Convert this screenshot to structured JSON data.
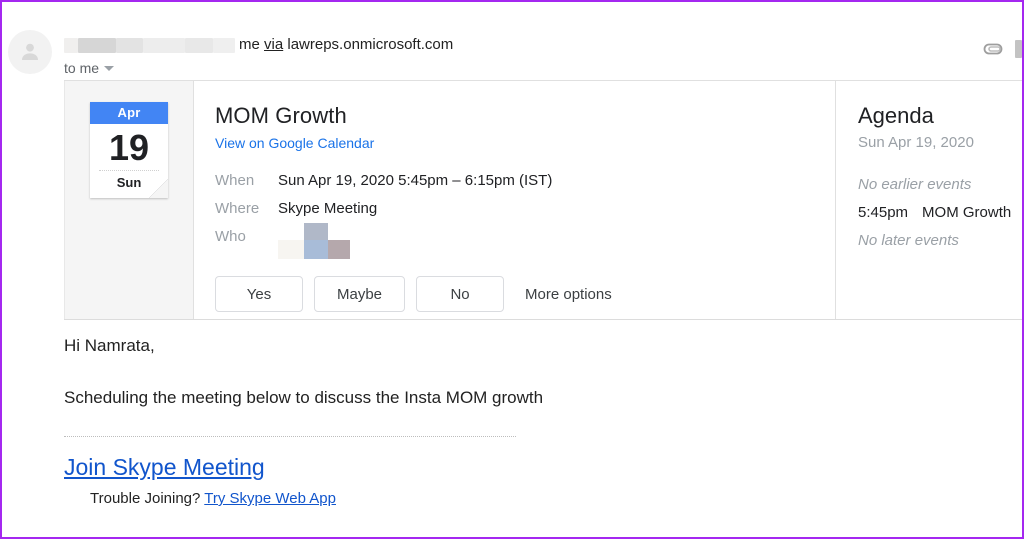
{
  "header": {
    "sender_redacted": true,
    "recipient_short": "me",
    "via_label": "via",
    "via_domain": "lawreps.onmicrosoft.com",
    "to_line": "to me",
    "attachment_icon": "paperclip-icon",
    "avatar_icon": "person-avatar-icon"
  },
  "invite": {
    "date_card": {
      "month": "Apr",
      "day": "19",
      "weekday": "Sun",
      "header_color": "#4285f4"
    },
    "title": "MOM Growth",
    "calendar_link": "View on Google Calendar",
    "link_color": "#1a73e8",
    "fields": [
      {
        "key": "When",
        "value": "Sun Apr 19, 2020 5:45pm – 6:15pm (IST)"
      },
      {
        "key": "Where",
        "value": "Skype Meeting"
      },
      {
        "key": "Who",
        "value": ""
      }
    ],
    "rsvp_buttons": [
      "Yes",
      "Maybe",
      "No"
    ],
    "more_options": "More options"
  },
  "agenda": {
    "title": "Agenda",
    "date": "Sun Apr 19, 2020",
    "no_earlier": "No earlier events",
    "no_later": "No later events",
    "event": {
      "time": "5:45pm",
      "name": "MOM Growth"
    }
  },
  "body": {
    "greeting": "Hi Namrata,",
    "paragraph": "Scheduling the meeting below to discuss the Insta MOM growth",
    "join_link": "Join Skype Meeting",
    "trouble_text": "Trouble Joining?",
    "trouble_link": "Try Skype Web App",
    "link_color": "#1155cc"
  }
}
